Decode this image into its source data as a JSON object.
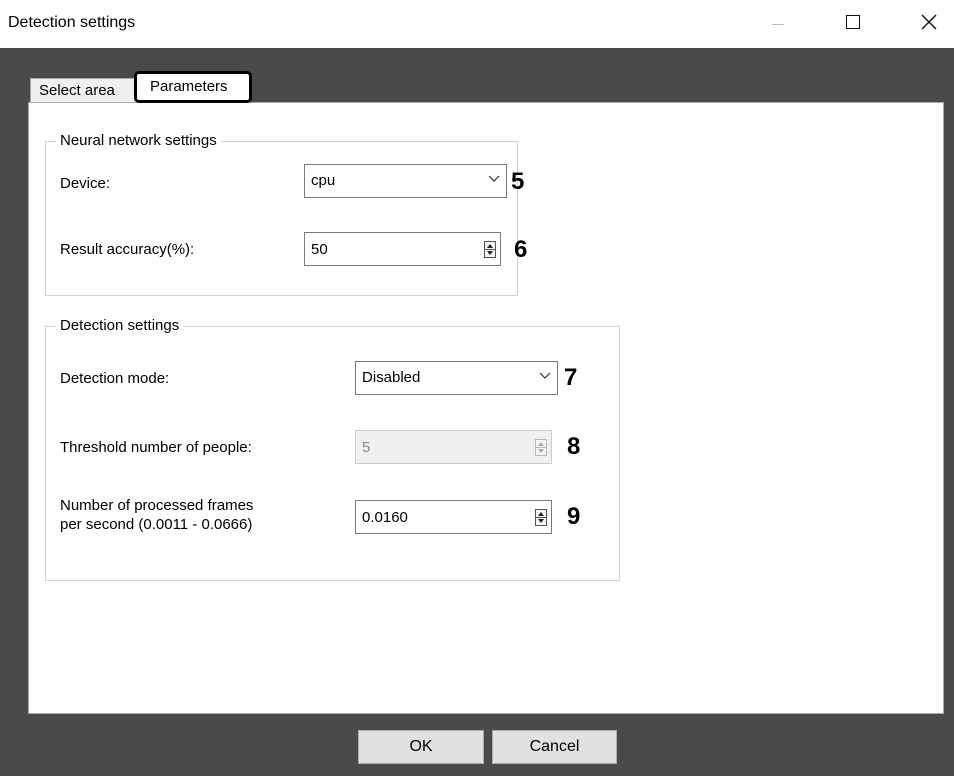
{
  "window": {
    "title": "Detection settings",
    "controls": {
      "minimize": "minimize-icon",
      "maximize": "maximize-icon",
      "close": "close-icon"
    }
  },
  "tabs": [
    {
      "label": "Select area",
      "active": false
    },
    {
      "label": "Parameters",
      "active": true
    }
  ],
  "neural": {
    "legend": "Neural network settings",
    "device_label": "Device:",
    "device_value": "cpu",
    "device_marker": "5",
    "accuracy_label": "Result accuracy(%):",
    "accuracy_value": "50",
    "accuracy_marker": "6"
  },
  "detection": {
    "legend": "Detection settings",
    "mode_label": "Detection mode:",
    "mode_value": "Disabled",
    "mode_marker": "7",
    "threshold_label": "Threshold number of people:",
    "threshold_value": "5",
    "threshold_enabled": false,
    "threshold_marker": "8",
    "fps_label_line1": "Number of processed frames",
    "fps_label_line2": "per second (0.0011 - 0.0666)",
    "fps_value": "0.0160",
    "fps_marker": "9"
  },
  "footer": {
    "ok_label": "OK",
    "cancel_label": "Cancel"
  }
}
